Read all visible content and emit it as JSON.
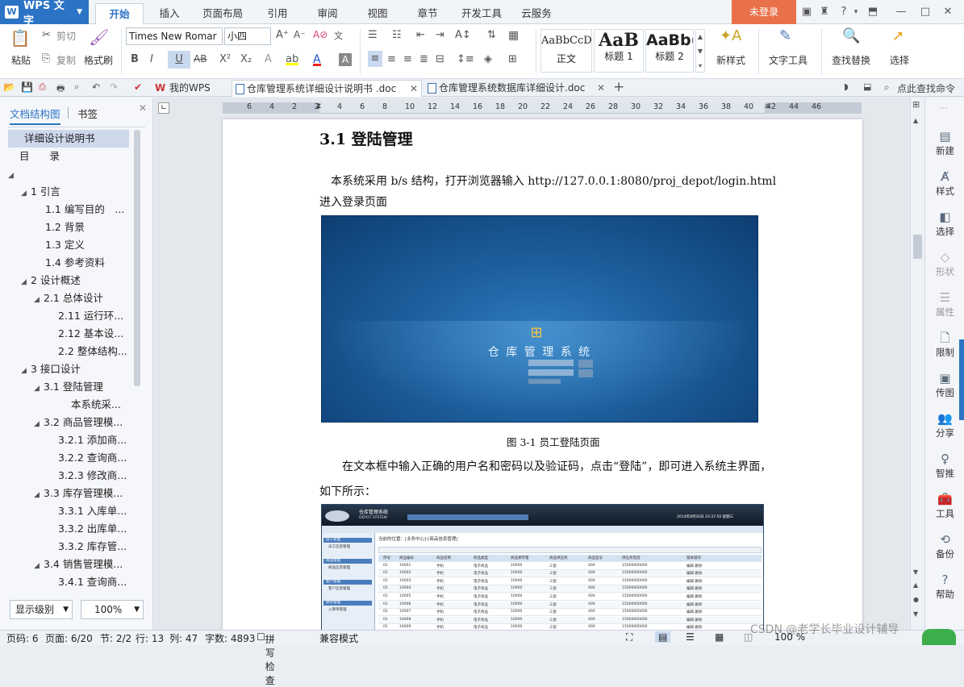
{
  "app": {
    "name": "WPS 文字",
    "login": "未登录"
  },
  "ribbon_tabs": [
    "开始",
    "插入",
    "页面布局",
    "引用",
    "审阅",
    "视图",
    "章节",
    "开发工具",
    "云服务"
  ],
  "ribbon": {
    "paste": "粘贴",
    "cut": "剪切",
    "copy": "复制",
    "format_painter": "格式刷",
    "font_name": "Times New Romar",
    "font_size": "小四",
    "styles": [
      {
        "preview": "AaBbCcD",
        "label": "正文"
      },
      {
        "preview": "AaB",
        "label": "标题 1"
      },
      {
        "preview": "AaBb(",
        "label": "标题 2"
      }
    ],
    "new_style": "新样式",
    "text_tools": "文字工具",
    "find_replace": "查找替换",
    "select": "选择"
  },
  "doc_tabs": [
    {
      "label": "我的WPS"
    },
    {
      "label": "仓库管理系统详细设计说明书 .doc",
      "active": true
    },
    {
      "label": "仓库管理系统数据库详细设计.doc"
    }
  ],
  "quick_find": "点此查找命令",
  "nav": {
    "tabs": [
      "文档结构图",
      "书签"
    ],
    "items": [
      {
        "label": "详细设计说明书",
        "level": 0,
        "selected": true
      },
      {
        "label": "目　　录",
        "level": 0
      },
      {
        "label": "",
        "level": 0,
        "tri": true
      },
      {
        "label": "1  引言",
        "level": 1,
        "tri": true
      },
      {
        "label": "1.1  编写目的　...",
        "level": 2
      },
      {
        "label": "1.2  背景",
        "level": 2
      },
      {
        "label": "1.3  定义",
        "level": 2
      },
      {
        "label": "1.4  参考资料",
        "level": 2
      },
      {
        "label": "2  设计概述",
        "level": 1,
        "tri": true
      },
      {
        "label": "2.1 总体设计",
        "level": 2,
        "tri": true
      },
      {
        "label": "2.11  运行环...",
        "level": 3
      },
      {
        "label": "2.12  基本设...",
        "level": 3
      },
      {
        "label": "2.2 整体结构...",
        "level": 3
      },
      {
        "label": "3  接口设计",
        "level": 1,
        "tri": true
      },
      {
        "label": "3.1 登陆管理",
        "level": 2,
        "tri": true
      },
      {
        "label": "本系统采...",
        "level": 4
      },
      {
        "label": "3.2  商品管理模...",
        "level": 2,
        "tri": true
      },
      {
        "label": "3.2.1  添加商...",
        "level": 3
      },
      {
        "label": "3.2.2  查询商...",
        "level": 3
      },
      {
        "label": "3.2.3  修改商...",
        "level": 3
      },
      {
        "label": "3.3  库存管理模...",
        "level": 2,
        "tri": true
      },
      {
        "label": "3.3.1  入库单...",
        "level": 3
      },
      {
        "label": "3.3.2  出库单...",
        "level": 3
      },
      {
        "label": "3.3.2  库存管...",
        "level": 3
      },
      {
        "label": "3.4  销售管理模...",
        "level": 2,
        "tri": true
      },
      {
        "label": "3.4.1  查询商...",
        "level": 3
      }
    ],
    "level_select": "显示级别",
    "zoom": "100%"
  },
  "ruler_ticks": [
    "6",
    "4",
    "2",
    "2",
    "4",
    "6",
    "8",
    "10",
    "12",
    "14",
    "16",
    "18",
    "20",
    "22",
    "24",
    "26",
    "28",
    "30",
    "32",
    "34",
    "36",
    "38",
    "40",
    "42",
    "44",
    "46"
  ],
  "document": {
    "heading": "3.1 登陆管理",
    "p1_line1": "本系统采用 b/s 结构，打开浏览器输入 http://127.0.0.1:8080/proj_depot/login.html",
    "p1_line2": "进入登录页面",
    "login_image_title": "仓 库 管 理 系 统",
    "caption": "图  3-1  员工登陆页面",
    "p2_line1": "在文本框中输入正确的用户名和密码以及验证码，点击“登陆”，即可进入系统主界面，",
    "p2_line2": "如下所示：",
    "main_image": {
      "title": "仓库管理系统",
      "subtitle": "DEPOT SYSTEM",
      "breadcrumb": "当前的位置：[业务中心]-[商品信息管理]",
      "date": "2014年8月20日 23:37:50 星期三",
      "side_sections": [
        "员工管理",
        "商品管理",
        "客户管理",
        "库存管理"
      ],
      "side_links": [
        "员工信息管理",
        "商品信息管理",
        "客户信息管理",
        "入库单管理"
      ],
      "columns": [
        "序号",
        "商品编号",
        "商品名称",
        "商品类型",
        "商品库存量",
        "商品供应商",
        "商品型号",
        "供应商电话",
        "基本操作"
      ],
      "rows": [
        [
          "01",
          "10001",
          "手机",
          "电子商品",
          "10000",
          "三星",
          "400",
          "15000000000",
          "编辑 删除"
        ],
        [
          "01",
          "10002",
          "手机",
          "电子商品",
          "10000",
          "三星",
          "400",
          "15000000000",
          "编辑 删除"
        ],
        [
          "01",
          "10003",
          "手机",
          "电子商品",
          "10000",
          "三星",
          "400",
          "15000000000",
          "编辑 删除"
        ],
        [
          "01",
          "10004",
          "手机",
          "电子商品",
          "10000",
          "三星",
          "400",
          "15000000000",
          "编辑 删除"
        ],
        [
          "01",
          "10005",
          "手机",
          "电子商品",
          "10000",
          "三星",
          "400",
          "15000000000",
          "编辑 删除"
        ],
        [
          "01",
          "10006",
          "手机",
          "电子商品",
          "10000",
          "三星",
          "400",
          "15000000000",
          "编辑 删除"
        ],
        [
          "01",
          "10007",
          "手机",
          "电子商品",
          "10000",
          "三星",
          "400",
          "15000000000",
          "编辑 删除"
        ],
        [
          "01",
          "10008",
          "手机",
          "电子商品",
          "10000",
          "三星",
          "400",
          "15000000000",
          "编辑 删除"
        ],
        [
          "01",
          "10009",
          "手机",
          "电子商品",
          "10000",
          "三星",
          "400",
          "15000000000",
          "编辑 删除"
        ]
      ]
    }
  },
  "right_sidebar": [
    "新建",
    "样式",
    "选择",
    "形状",
    "属性",
    "限制",
    "传图",
    "分享",
    "智推",
    "工具",
    "备份",
    "帮助"
  ],
  "status": {
    "page_num": "页码: 6",
    "pages": "页面: 6/20",
    "section": "节: 2/2",
    "line": "行: 13",
    "col": "列: 47",
    "words": "字数: 4893",
    "spell": "拼写检查",
    "compat": "兼容模式",
    "zoom": "100 %",
    "watermark": "CSDN @老学长毕业设计辅导"
  },
  "colors": {
    "accent": "#2b73c5",
    "login_bg": "#1c5e9c",
    "login_button": "#e9714a"
  }
}
